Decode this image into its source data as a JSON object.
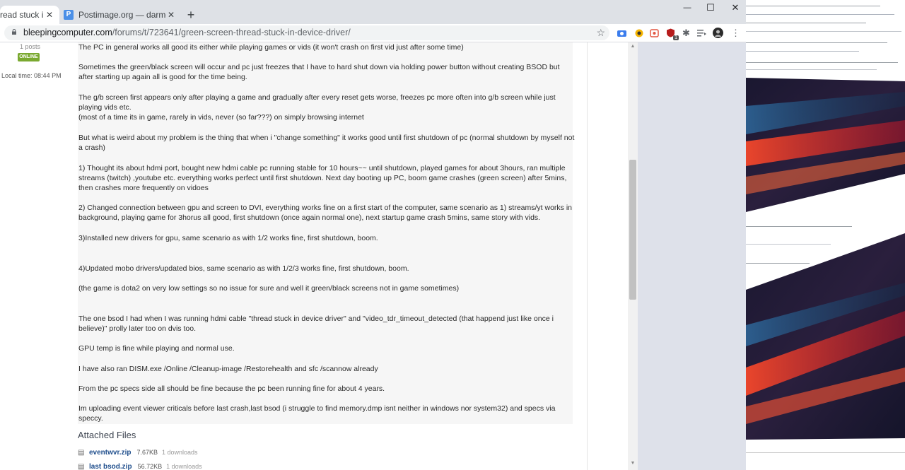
{
  "browser": {
    "tabs": [
      {
        "title": "read stuck in dev",
        "favicon": "bleepingcomputer-favicon",
        "active": true
      },
      {
        "title": "Postimage.org — darmowy hostin",
        "favicon": "P",
        "active": false
      }
    ],
    "new_tab_icon": "plus-icon",
    "window_buttons": {
      "minimize": "—",
      "maximize": "☐",
      "close": "✕"
    },
    "url_domain": "bleepingcomputer.com",
    "url_path": "/forums/t/723641/green-screen-thread-stuck-in-device-driver/",
    "extension_badge": "1"
  },
  "user_panel": {
    "posts": "1 posts",
    "status": "ONLINE",
    "local_time_label": "Local time:",
    "local_time": "08:44 PM"
  },
  "post": {
    "paragraphs": [
      "The PC in general works all good its either while playing games or vids (it won't crash on first vid just after some time)",
      "Sometimes the green/black screen will occur and pc just freezes that I have to hard shut down via holding power button without creating BSOD but after starting up again all is good for the time being.",
      "The g/b screen first appears only after playing a game and gradually after every reset gets worse, freezes pc more often into g/b screen while just playing vids etc.",
      "(most of a time its in game, rarely in vids, never (so far???) on simply browsing internet",
      "But what is weird about my problem is the thing that when i \"change something\" it works good until first shutdown of pc (normal shutdown by myself not  a crash)",
      "1) Thought its about hdmi port, bought new hdmi cable pc running stable for 10 hours~~ until shutdown, played games for about 3hours, ran multiple streams (twitch) ,youtube etc. everything works perfect until first shutdown. Next day booting up PC, boom game crashes (green screen) after 5mins, then crashes more frequently on vidoes",
      "2) Changed connection between gpu and screen to DVI, everything works fine on a first start of the computer, same scenario as 1) streams/yt works in background, playing game for 3horus all good, first shutdown (once again normal one), next startup game crash 5mins, same story with vids.",
      "3)Installed new drivers for gpu, same scenario as with 1/2 works fine, first shutdown, boom.",
      "4)Updated mobo drivers/updated bios, same scenario as with 1/2/3 works fine, first shutdown, boom.",
      "(the game is dota2 on very low settings so no issue for sure and well it green/black screens not in game sometimes)",
      "The one bsod I had when I was running hdmi cable \"thread stuck in device driver\" and \"video_tdr_timeout_detected (that happend just like once i believe)\" prolly later too on dvis too.",
      "GPU temp is fine while playing and normal use.",
      "I have also ran DISM.exe /Online /Cleanup-image /Restorehealth and sfc /scannow already",
      "From the pc specs side all should be fine because the pc been running fine for about 4 years.",
      "Im uploading event viewer criticals before last crash,last bsod (i struggle to find memory.dmp isnt neither in windows nor system32) and specs via speccy."
    ]
  },
  "attachments": {
    "title": "Attached Files",
    "files": [
      {
        "name": "eventwvr.zip",
        "size": "7.67KB",
        "downloads": "1 downloads"
      },
      {
        "name": "last bsod.zip",
        "size": "56.72KB",
        "downloads": "1 downloads"
      }
    ]
  }
}
